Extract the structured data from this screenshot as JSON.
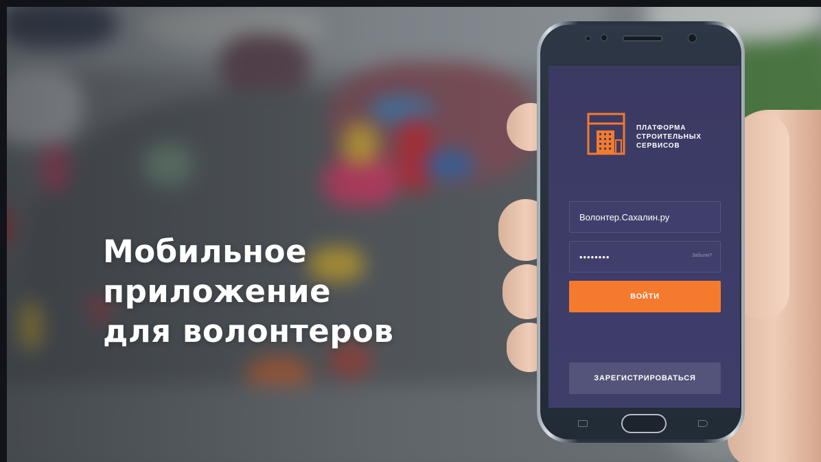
{
  "headline": {
    "line1": "Мобильное",
    "line2": "приложение",
    "line3": "для волонтеров"
  },
  "app": {
    "brand_line1": "ПЛАТФОРМА",
    "brand_line2": "СТРОИТЕЛЬНЫХ",
    "brand_line3": "СЕРВИСОВ",
    "login_value": "Волонтер.Сахалин.ру",
    "password_value": "••••••••",
    "forgot_label": "Забыли?",
    "login_button": "ВОЙТИ",
    "register_button": "ЗАРЕГИСТРИРОВАТЬСЯ"
  },
  "colors": {
    "screen_bg": "#3d3c68",
    "accent": "#f47a2e",
    "secondary_button": "#545379",
    "headline_text": "#ffffff"
  }
}
